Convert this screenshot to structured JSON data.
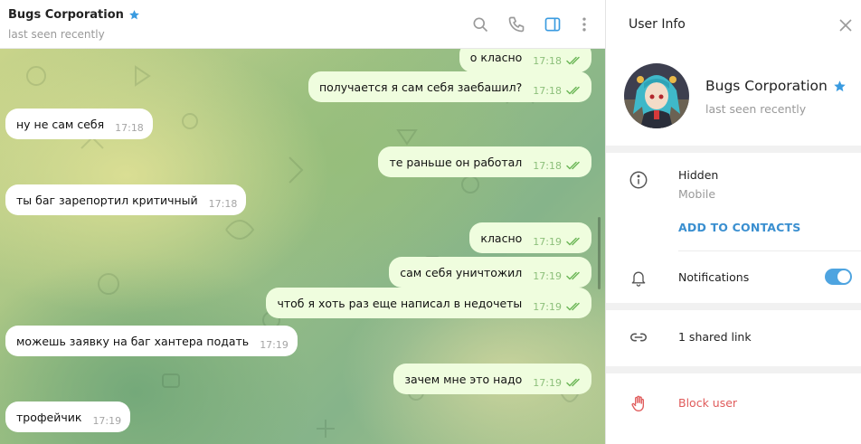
{
  "chat": {
    "name": "Bugs Corporation",
    "status": "last seen recently",
    "header_icons": [
      "search-icon",
      "phone-icon",
      "sidebar-toggle-icon",
      "more-vertical-icon"
    ],
    "messages": [
      {
        "direction": "out",
        "text": "о класно",
        "time": "17:18"
      },
      {
        "direction": "out",
        "text": "получается я сам себя заебашил?",
        "time": "17:18"
      },
      {
        "direction": "in",
        "text": "ну не сам себя",
        "time": "17:18"
      },
      {
        "direction": "out",
        "text": "те раньше он работал",
        "time": "17:18"
      },
      {
        "direction": "in",
        "text": "ты баг зарепортил критичный",
        "time": "17:18"
      },
      {
        "direction": "out",
        "text": "класно",
        "time": "17:19"
      },
      {
        "direction": "out",
        "text": "сам себя уничтожил",
        "time": "17:19"
      },
      {
        "direction": "out",
        "text": "чтоб я хоть раз еще написал в недочеты",
        "time": "17:19"
      },
      {
        "direction": "in",
        "text": "можешь заявку на баг хантера подать",
        "time": "17:19"
      },
      {
        "direction": "out",
        "text": "зачем мне это надо",
        "time": "17:19"
      },
      {
        "direction": "in",
        "text": "трофейчик",
        "time": "17:19"
      }
    ]
  },
  "panel": {
    "title": "User Info",
    "profile_name": "Bugs Corporation",
    "profile_status": "last seen recently",
    "info_value": "Hidden",
    "info_label": "Mobile",
    "add_contacts": "ADD TO CONTACTS",
    "notifications_label": "Notifications",
    "notifications_on": true,
    "shared_links": "1 shared link",
    "block_user": "Block user"
  },
  "colors": {
    "accent": "#3a8fd0",
    "toggle": "#4ea4e0",
    "outgoing_bubble": "#effdde",
    "danger": "#e05b5b",
    "read_ticks": "#6fb85a"
  }
}
